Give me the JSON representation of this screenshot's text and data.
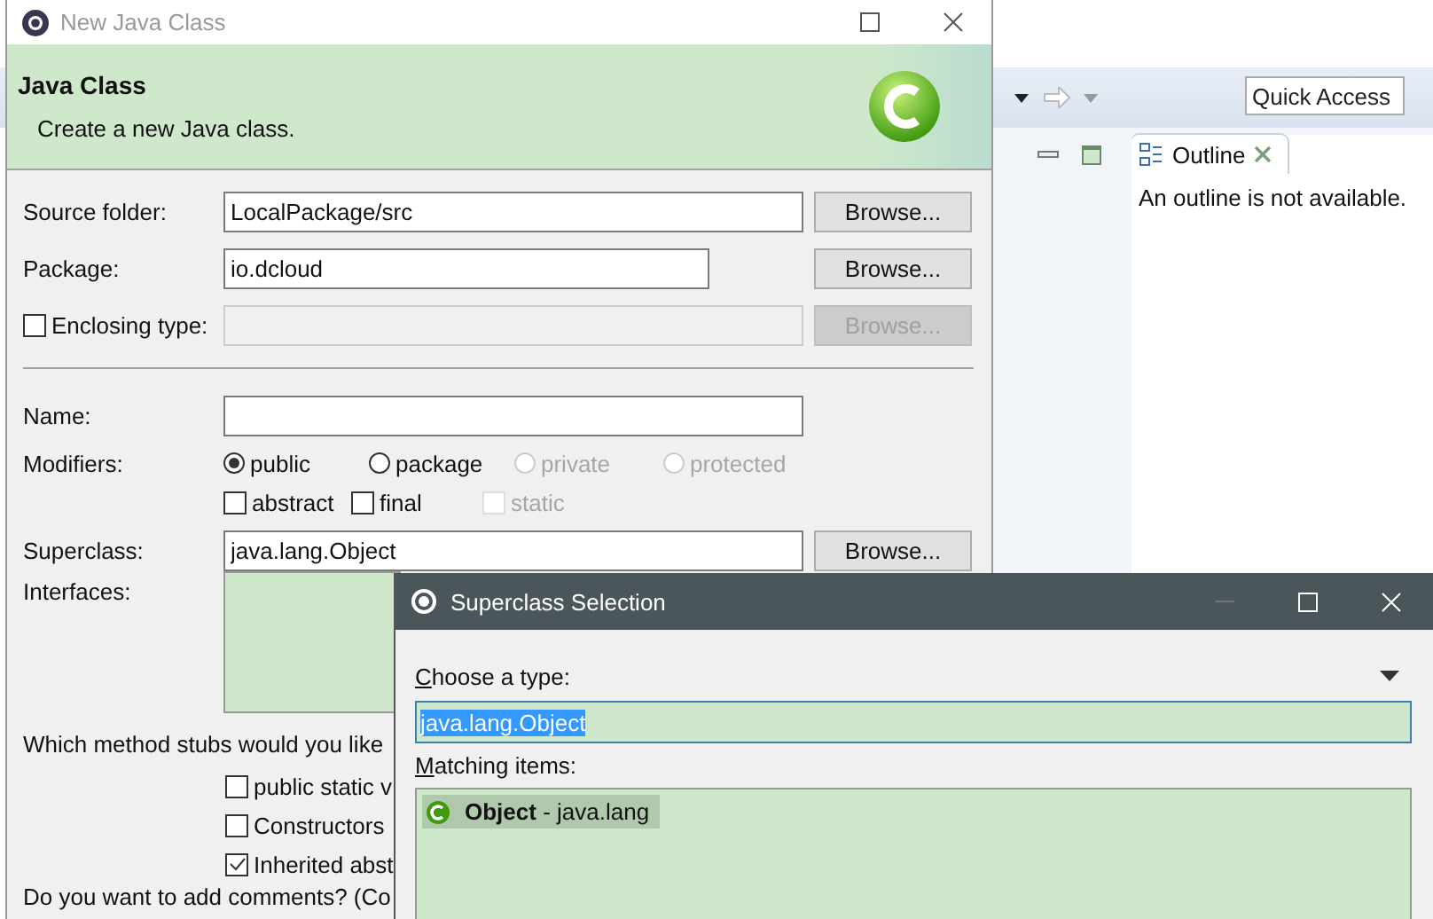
{
  "ide": {
    "quick_access": {
      "placeholder": "Quick Access"
    },
    "outline_tab": {
      "label": "Outline",
      "selected": true
    },
    "outline_message": "An outline is not available."
  },
  "new_class_dialog": {
    "title": "New Java Class",
    "header_title": "Java Class",
    "header_description": "Create a new Java class.",
    "source_folder": {
      "label": "Source folder:",
      "value": "LocalPackage/src",
      "button": "Browse..."
    },
    "package": {
      "label": "Package:",
      "value": "io.dcloud",
      "button": "Browse..."
    },
    "enclosing_type": {
      "label": "Enclosing type:",
      "checked": false,
      "disabled": true,
      "button": "Browse..."
    },
    "name": {
      "label": "Name:"
    },
    "modifiers": {
      "label": "Modifiers:",
      "options": [
        {
          "label": "public",
          "selected": true,
          "disabled": false
        },
        {
          "label": "package",
          "selected": false,
          "disabled": false
        },
        {
          "label": "private",
          "selected": false,
          "disabled": true
        },
        {
          "label": "protected",
          "selected": false,
          "disabled": true
        }
      ],
      "flags": [
        {
          "label": "abstract",
          "checked": false,
          "disabled": false
        },
        {
          "label": "final",
          "checked": false,
          "disabled": false
        },
        {
          "label": "static",
          "checked": false,
          "disabled": true
        }
      ]
    },
    "superclass": {
      "label": "Superclass:",
      "value": "java.lang.Object",
      "button": "Browse..."
    },
    "interfaces": {
      "label": "Interfaces:"
    },
    "method_stubs": {
      "question": "Which method stubs would you like",
      "options": [
        {
          "label": "public static v",
          "checked": false
        },
        {
          "label": "Constructors",
          "checked": false
        },
        {
          "label": "Inherited abst",
          "checked": true
        }
      ]
    },
    "comments_question": "Do you want to add comments? (Co"
  },
  "superclass_dialog": {
    "title": "Superclass Selection",
    "choose_label": "Choose a type:",
    "filter": {
      "value": "java.lang.Object"
    },
    "matching_label": "Matching items:",
    "items": [
      {
        "text": "**Object** - java.lang",
        "selected": true
      }
    ]
  }
}
